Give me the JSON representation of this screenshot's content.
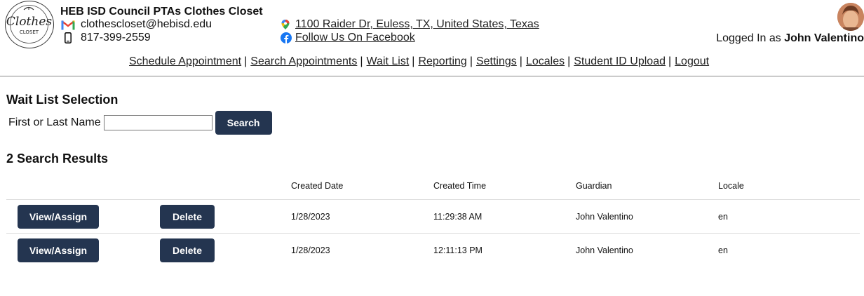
{
  "header": {
    "logo_text": "Clothes",
    "logo_sub": "CLOSET",
    "org_name": "HEB ISD Council PTAs Clothes Closet",
    "email": "clothescloset@hebisd.edu",
    "phone": "817-399-2559",
    "address": "1100 Raider Dr, Euless, TX, United States, Texas",
    "facebook": "Follow Us On Facebook",
    "login_prefix": "Logged In as ",
    "login_user": "John Valentino"
  },
  "nav": {
    "items": [
      "Schedule Appointment",
      "Search Appointments",
      "Wait List",
      "Reporting",
      "Settings",
      "Locales",
      "Student ID Upload",
      "Logout"
    ],
    "separator": "|"
  },
  "wait_list": {
    "title": "Wait List Selection",
    "name_label": "First or Last Name",
    "name_value": "",
    "search_label": "Search"
  },
  "results": {
    "title": "2 Search Results",
    "columns": [
      "",
      "",
      "Created Date",
      "Created Time",
      "Guardian",
      "Locale"
    ],
    "view_label": "View/Assign",
    "delete_label": "Delete",
    "rows": [
      {
        "date": "1/28/2023",
        "time": "11:29:38 AM",
        "guardian": "John Valentino",
        "locale": "en"
      },
      {
        "date": "1/28/2023",
        "time": "12:11:13 PM",
        "guardian": "John Valentino",
        "locale": "en"
      }
    ]
  },
  "colors": {
    "button_bg": "#243550",
    "button_text": "#ffffff"
  }
}
